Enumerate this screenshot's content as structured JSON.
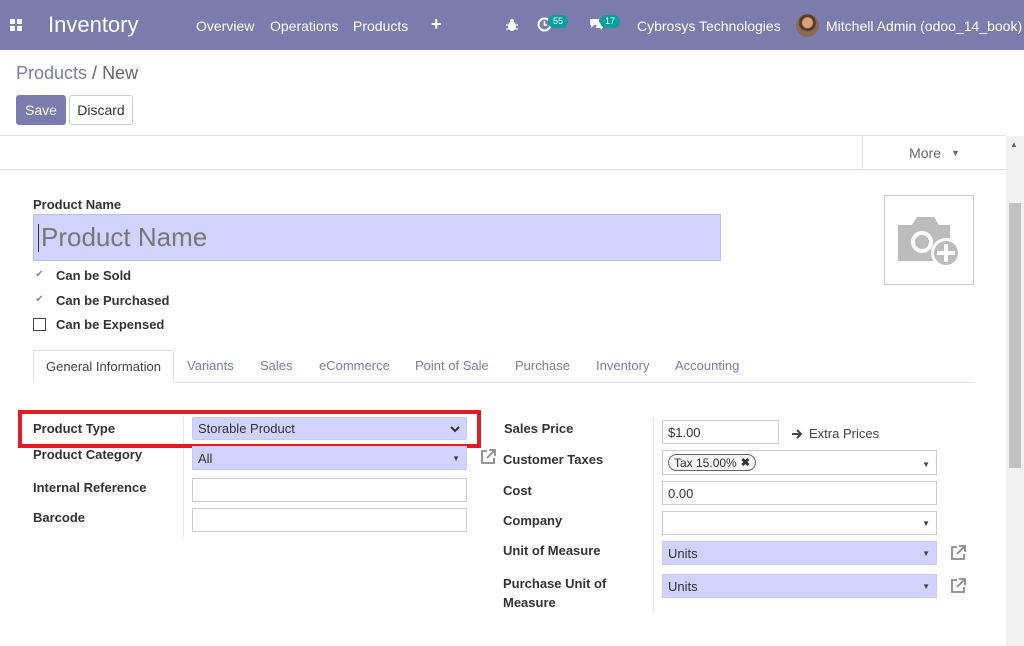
{
  "navbar": {
    "app_title": "Inventory",
    "menu": [
      "Overview",
      "Operations",
      "Products"
    ],
    "plus_icon": "+",
    "activity_count": "55",
    "messages_count": "17",
    "company": "Cybrosys Technologies",
    "user": "Mitchell Admin (odoo_14_book)"
  },
  "breadcrumb": {
    "parent": "Products",
    "sep": "/",
    "current": "New"
  },
  "buttons": {
    "save": "Save",
    "discard": "Discard",
    "more": "More"
  },
  "form": {
    "name_label": "Product Name",
    "name_placeholder": "Product Name",
    "checks": [
      {
        "label": "Can be Sold",
        "checked": true
      },
      {
        "label": "Can be Purchased",
        "checked": true
      },
      {
        "label": "Can be Expensed",
        "checked": false
      }
    ],
    "tabs": [
      "General Information",
      "Variants",
      "Sales",
      "eCommerce",
      "Point of Sale",
      "Purchase",
      "Inventory",
      "Accounting"
    ],
    "left": {
      "product_type_label": "Product Type",
      "product_type_value": "Storable Product",
      "category_label": "Product Category",
      "category_value": "All",
      "internal_ref_label": "Internal Reference",
      "internal_ref_value": "",
      "barcode_label": "Barcode",
      "barcode_value": ""
    },
    "right": {
      "sales_price_label": "Sales Price",
      "sales_price_value": "$1.00",
      "extra_prices": "Extra Prices",
      "customer_taxes_label": "Customer Taxes",
      "customer_taxes_tag": "Tax 15.00%",
      "cost_label": "Cost",
      "cost_value": "0.00",
      "company_label": "Company",
      "company_value": "",
      "uom_label": "Unit of Measure",
      "uom_value": "Units",
      "purchase_uom_label_1": "Purchase Unit of",
      "purchase_uom_label_2": "Measure",
      "purchase_uom_value": "Units"
    }
  },
  "colors": {
    "brand": "#7c7bad",
    "required_bg": "#d2d2ff",
    "highlight": "#e21b26"
  }
}
